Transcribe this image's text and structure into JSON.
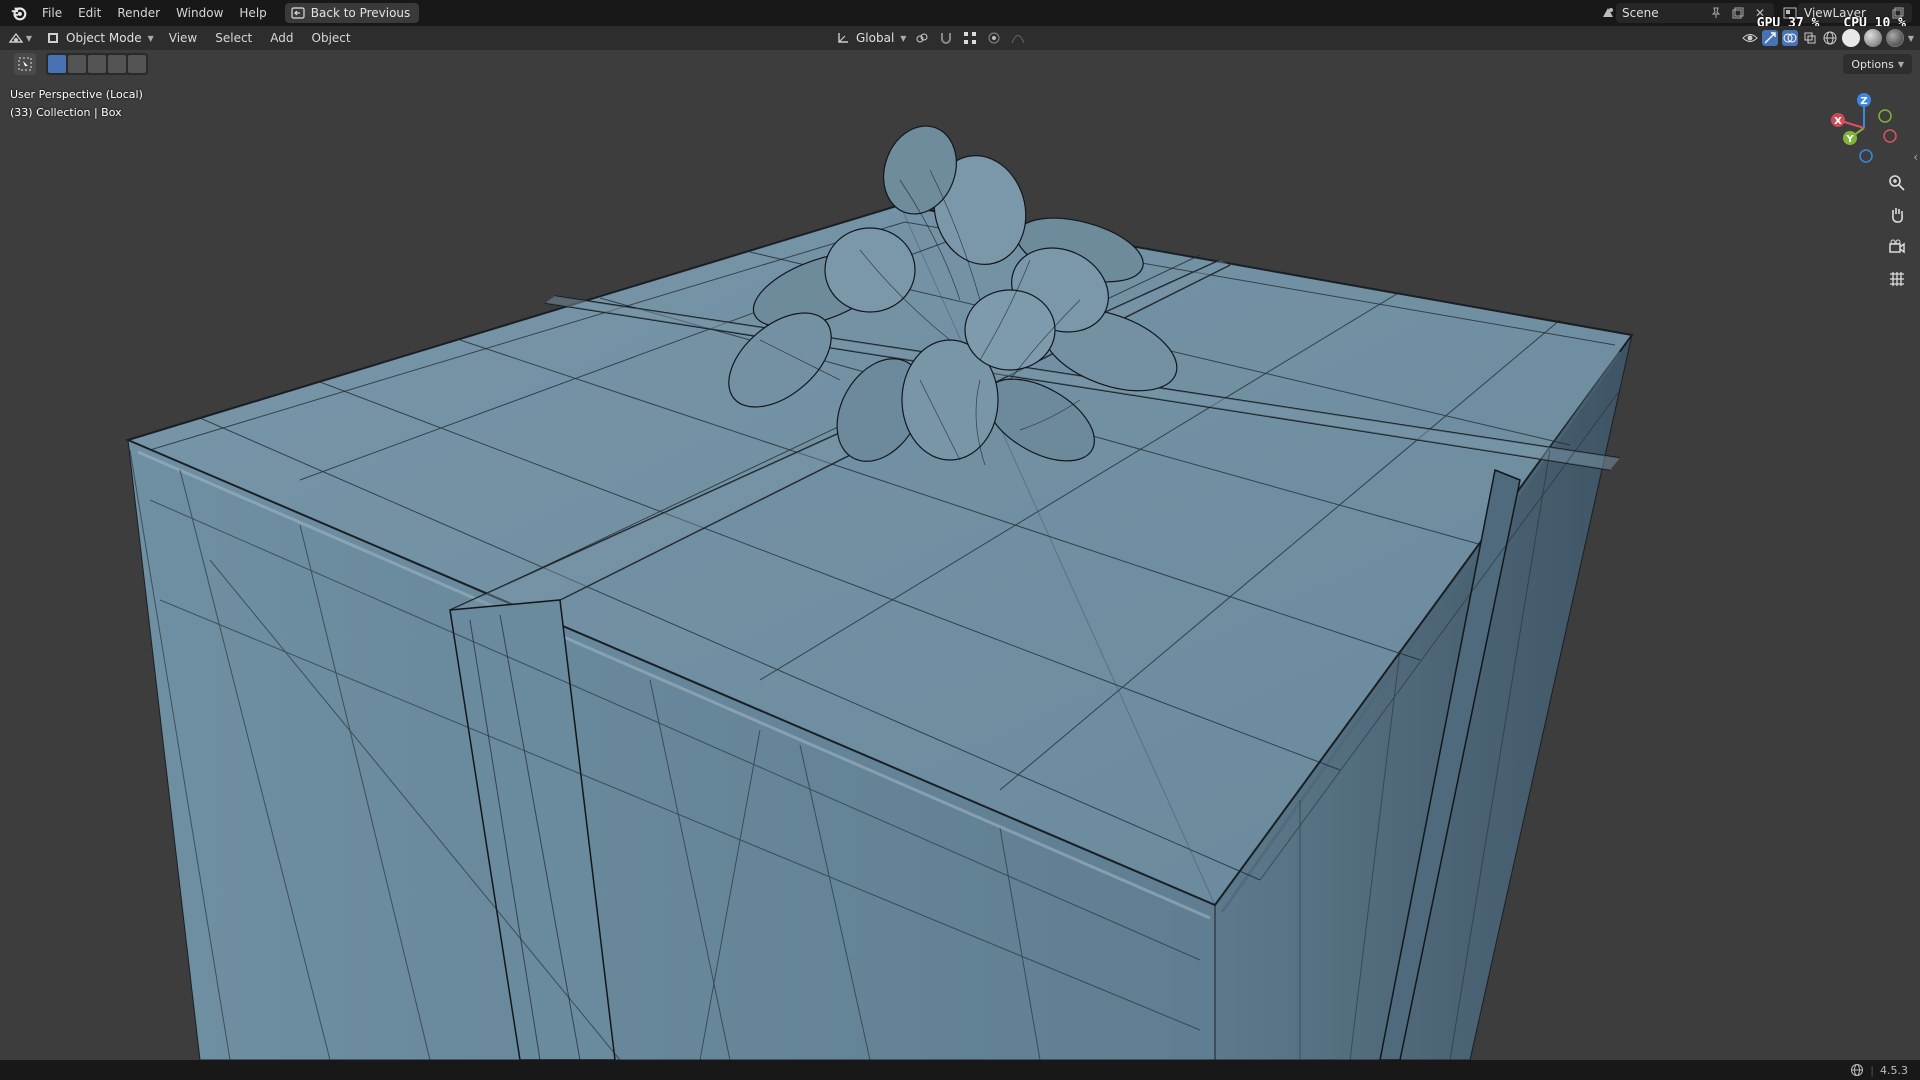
{
  "topbar": {
    "menus": [
      "File",
      "Edit",
      "Render",
      "Window",
      "Help"
    ],
    "back_button": "Back to Previous",
    "scene_label": "Scene",
    "viewlayer_label": "ViewLayer",
    "gpu_stat": "GPU 37 %",
    "cpu_stat": "CPU 10 %"
  },
  "viewport_header": {
    "mode": "Object Mode",
    "menus": [
      "View",
      "Select",
      "Add",
      "Object"
    ],
    "transform_orientation": "Global"
  },
  "tool_header": {
    "options_label": "Options"
  },
  "viewport": {
    "view_name": "User Perspective (Local)",
    "collection_info": "(33) Collection | Box",
    "object_color": "#6f8da0",
    "wire_color": "#1a1f24"
  },
  "gizmo": {
    "z": "Z",
    "y": "Y",
    "x": "X",
    "x_color": "#e0505e",
    "y_color": "#7fb43a",
    "z_color": "#3e86e0"
  },
  "statusbar": {
    "version": "4.5.3"
  }
}
